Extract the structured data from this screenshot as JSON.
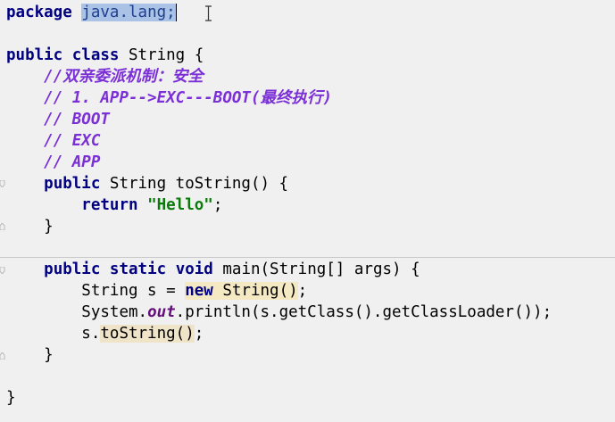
{
  "code": {
    "line1": {
      "kw": "package",
      "pkg": "java.lang;"
    },
    "line3": {
      "kw1": "public",
      "kw2": "class",
      "name": "String {"
    },
    "line4": {
      "comment": "//双亲委派机制：安全"
    },
    "line5": {
      "comment": "// 1. APP-->EXC---BOOT(最终执行)"
    },
    "line6": {
      "comment": "// BOOT"
    },
    "line7": {
      "comment": "// EXC"
    },
    "line8": {
      "comment": "// APP"
    },
    "line9": {
      "kw": "public",
      "rest": " String toString() {"
    },
    "line10": {
      "kw": "return",
      "str": "\"Hello\"",
      "end": ";"
    },
    "line11": {
      "text": "}"
    },
    "line13": {
      "kw1": "public",
      "kw2": "static",
      "kw3": "void",
      "rest": " main(String[] args) {"
    },
    "line14": {
      "a": "String s = ",
      "kw": "new",
      "b": " String",
      "c": "()",
      "d": ";"
    },
    "line15": {
      "a": "System.",
      "field": "out",
      "b": ".println(s.getClass().getClassLoader());"
    },
    "line16": {
      "a": "s.",
      "method": "toString",
      "b": "()",
      "c": ";"
    },
    "line17": {
      "text": "}"
    },
    "line19": {
      "text": "}"
    }
  }
}
